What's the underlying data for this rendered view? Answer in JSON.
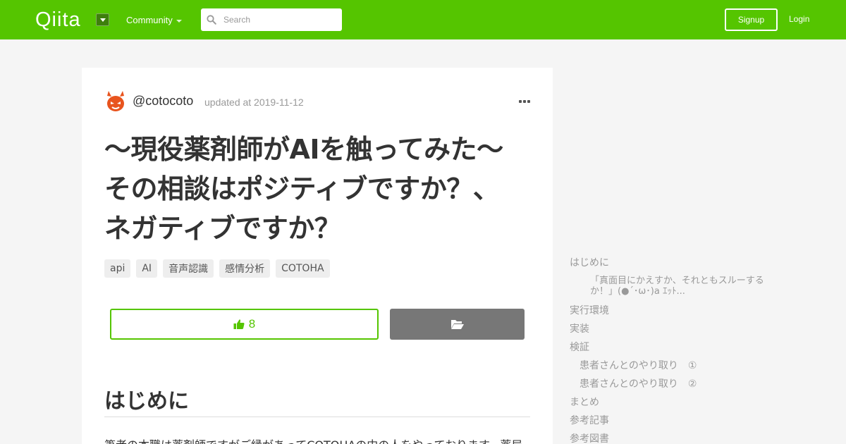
{
  "header": {
    "logo": "Qiita",
    "community_label": "Community",
    "search_placeholder": "Search",
    "signup_label": "Signup",
    "login_label": "Login",
    "brand_color": "#55c500"
  },
  "article": {
    "author": "@cotocoto",
    "updated": "updated at 2019-11-12",
    "title": "～現役薬剤師がAIを触ってみた～　その相談はポジティブですか？、ネガティブですか？",
    "tags": [
      "api",
      "AI",
      "音声認識",
      "感情分析",
      "COTOHA"
    ],
    "likes": "8",
    "section_heading": "はじめに",
    "body_text": "筆者の本職は薬剤師ですがご縁があってCOTOHAの中の人をやっております。薬局"
  },
  "toc": {
    "items": [
      "はじめに",
      "「真面目にかえすか、それともスルーするか！」(●´･ω･)a ｴｯﾄ...",
      "実行環境",
      "実装",
      "検証",
      "患者さんとのやり取り　①",
      "患者さんとのやり取り　②",
      "まとめ",
      "参考記事",
      "参考図書"
    ]
  }
}
